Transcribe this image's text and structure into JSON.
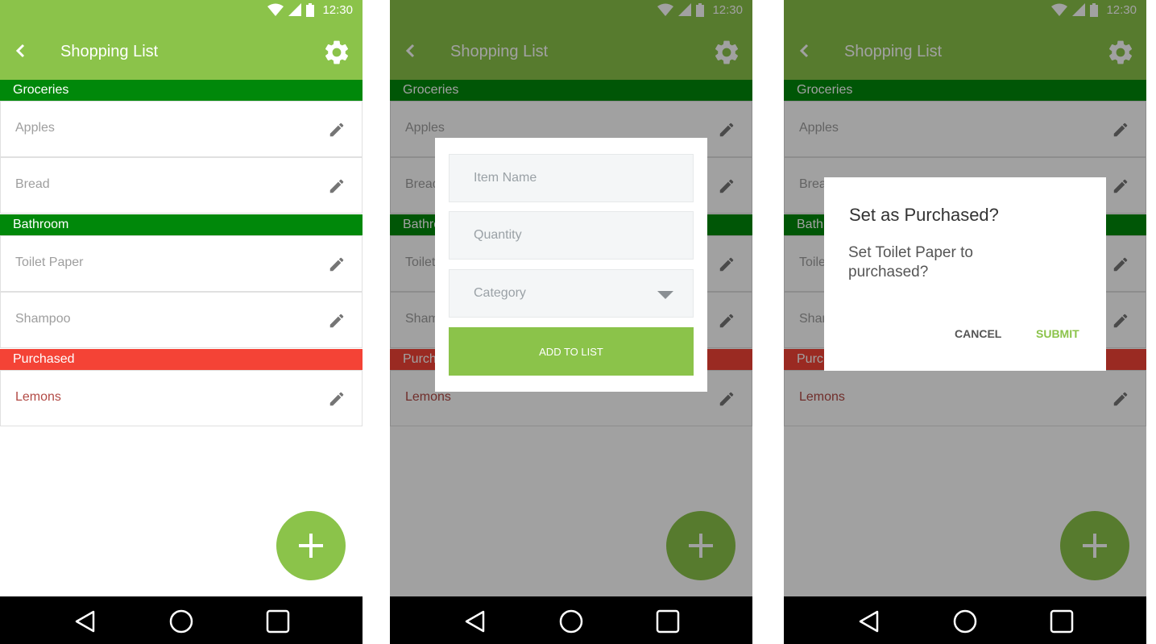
{
  "colors": {
    "primary": "#8bc34a",
    "section_green": "#00880a",
    "section_red": "#f44336",
    "purchased_text": "#b24a45",
    "item_text": "#9e9e9e"
  },
  "status_bar": {
    "time": "12:30",
    "icons": [
      "wifi-icon",
      "signal-icon",
      "battery-icon"
    ]
  },
  "app_bar": {
    "title": "Shopping List",
    "back_icon": "back-arrow-icon",
    "settings_icon": "gear-icon"
  },
  "sections": [
    {
      "title": "Groceries",
      "color": "green",
      "items": [
        "Apples",
        "Bread"
      ]
    },
    {
      "title": "Bathroom",
      "color": "green",
      "items": [
        "Toilet Paper",
        "Shampoo"
      ]
    },
    {
      "title": "Purchased",
      "color": "red",
      "items": [
        "Lemons"
      ]
    }
  ],
  "list": {
    "groceries_title": "Groceries",
    "apples": "Apples",
    "bread": "Bread",
    "bathroom_title": "Bathroom",
    "toilet_paper": "Toilet Paper",
    "shampoo": "Shampoo",
    "purchased_title": "Purchased",
    "lemons": "Lemons",
    "edit_icon": "pencil-icon"
  },
  "fab": {
    "icon": "plus-icon"
  },
  "nav_bar": {
    "icons": [
      "back-triangle-icon",
      "home-circle-icon",
      "recents-square-icon"
    ]
  },
  "add_dialog": {
    "item_name_placeholder": "Item Name",
    "quantity_placeholder": "Quantity",
    "category_placeholder": "Category",
    "submit_label": "ADD TO LIST"
  },
  "confirm_dialog": {
    "title": "Set as Purchased?",
    "message": "Set Toilet Paper to purchased?",
    "cancel_label": "CANCEL",
    "submit_label": "SUBMIT"
  }
}
